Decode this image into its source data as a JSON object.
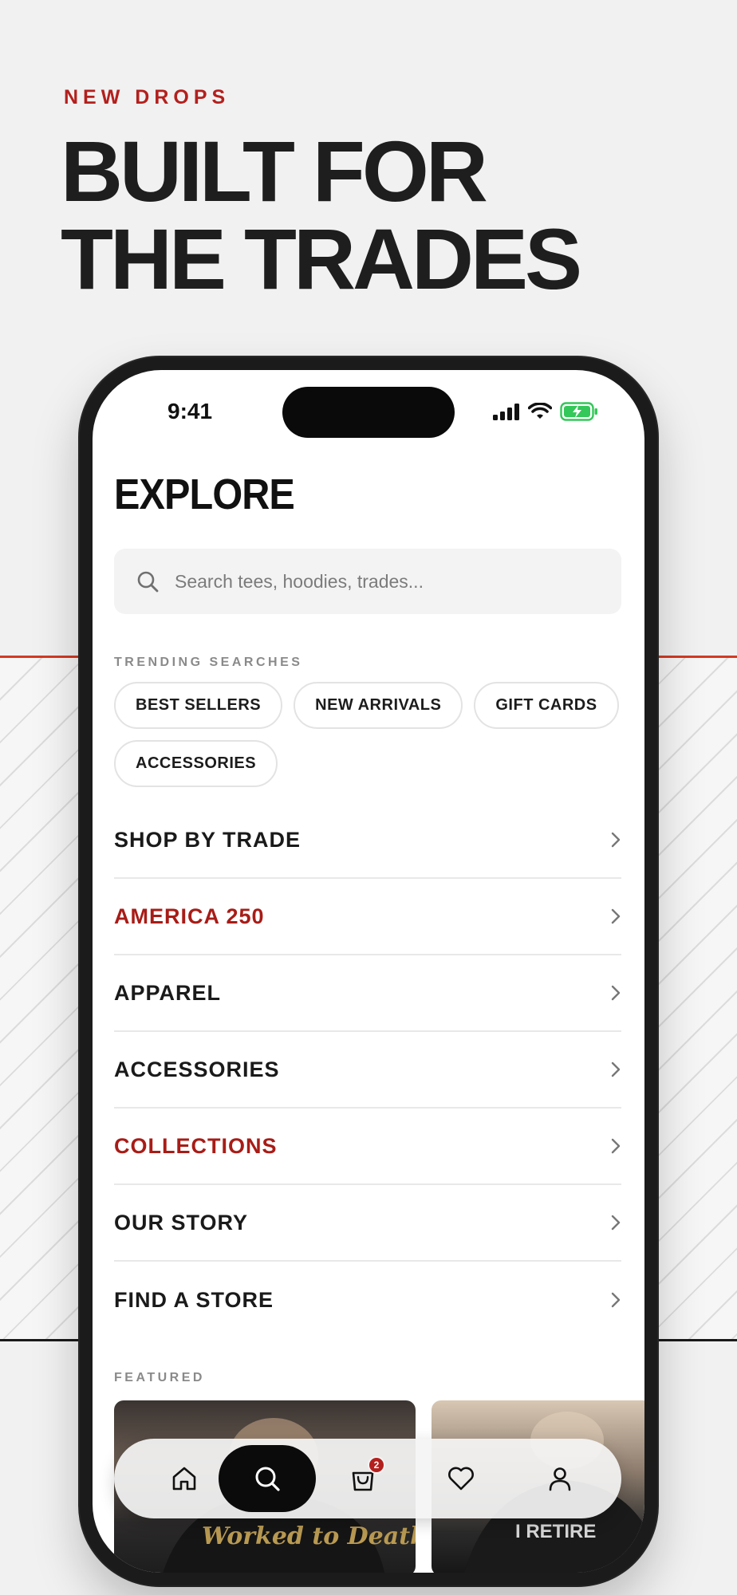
{
  "promo": {
    "eyebrow": "NEW DROPS",
    "headline_line1": "BUILT FOR",
    "headline_line2": "THE TRADES"
  },
  "status_bar": {
    "time": "9:41",
    "battery_color": "#34c759"
  },
  "explore": {
    "title": "EXPLORE",
    "search_placeholder": "Search tees, hoodies, trades...",
    "trending_label": "TRENDING SEARCHES",
    "trending": [
      "BEST SELLERS",
      "NEW ARRIVALS",
      "GIFT CARDS",
      "ACCESSORIES"
    ],
    "menu": [
      {
        "label": "SHOP BY TRADE",
        "highlight": false
      },
      {
        "label": "AMERICA 250",
        "highlight": true
      },
      {
        "label": "APPAREL",
        "highlight": false
      },
      {
        "label": "ACCESSORIES",
        "highlight": false
      },
      {
        "label": "COLLECTIONS",
        "highlight": true
      },
      {
        "label": "OUR STORY",
        "highlight": false
      },
      {
        "label": "FIND A STORE",
        "highlight": false
      }
    ],
    "featured_label": "FEATURED",
    "featured_cards": [
      {
        "print": "Worked to Death"
      },
      {
        "print": "I RETIRE"
      }
    ]
  },
  "tabbar": {
    "tabs": [
      {
        "icon": "home-icon",
        "active": false
      },
      {
        "icon": "search-icon",
        "active": true
      },
      {
        "icon": "shopping-bag-icon",
        "active": false,
        "badge": "2"
      },
      {
        "icon": "heart-icon",
        "active": false
      },
      {
        "icon": "user-icon",
        "active": false
      }
    ]
  },
  "colors": {
    "accent_red": "#b3201d",
    "background": "#f1f1f1",
    "text_dark": "#1b1b1b"
  }
}
